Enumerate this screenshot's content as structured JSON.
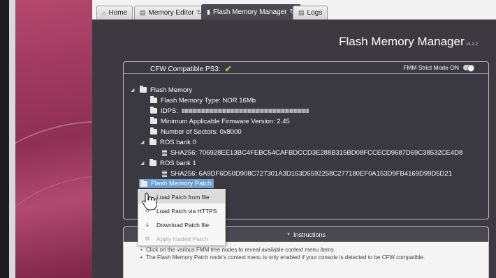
{
  "tabs": [
    {
      "label": "Home",
      "icon": "home-icon",
      "glyph": "⌂",
      "active": false
    },
    {
      "label": "Memory Editor",
      "icon": "memory-editor-icon",
      "glyph": "▤",
      "refresh": true,
      "active": false
    },
    {
      "label": "Flash Memory Manager",
      "icon": "flash-icon",
      "glyph": "▮",
      "refresh": true,
      "active": true
    },
    {
      "label": "Logs",
      "icon": "logs-icon",
      "glyph": "▤",
      "active": false
    }
  ],
  "header": {
    "title": "Flash Memory Manager",
    "version": "v1.2.2"
  },
  "status": {
    "compat_label": "CFW Compatible PS3:",
    "strict_label": "FMM Strict Mode ON"
  },
  "tree": {
    "root": "Flash Memory",
    "type": "Flash Memory Type: NOR 16Mb",
    "idps_label": "IDPS:",
    "min_fw": "Minimum Applicable Firmware Version: 2.45",
    "sectors": "Number of Sectors: 0x8000",
    "ros0": "ROS bank 0",
    "ros0_sha": "SHA256: 706928EE13BC4FEBC54CAFBDCCD3E288B315BD08FCCECD9687D69C38532CE4D8",
    "ros1": "ROS bank 1",
    "ros1_sha": "SHA256: 6A9DF6D50D908C727301A3D163D5592258C277180EF0A153D9FB4169D99D5D21",
    "patch": "Flash Memory Patch"
  },
  "context_menu": {
    "items": [
      {
        "label": "Load Patch from file",
        "icon": "load-file-icon"
      },
      {
        "label": "Load Patch via HTTPS",
        "icon": "https-icon"
      },
      {
        "label": "Download Patch file",
        "icon": "download-icon"
      },
      {
        "label": "Apply loaded Patch",
        "icon": "apply-icon",
        "disabled": true
      }
    ]
  },
  "instructions": {
    "title": "Instructions",
    "items": [
      "Click on the various FMM tree nodes to reveal available context menu items.",
      "The Flash Memory Patch node's context menu is only enabled if your console is detected to be CFW compatible."
    ]
  }
}
